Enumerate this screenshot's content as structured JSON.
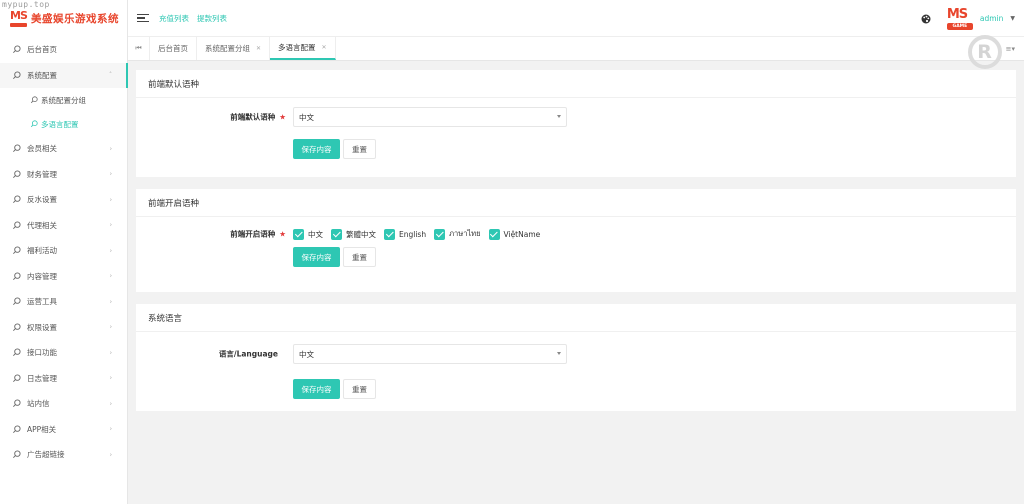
{
  "app": {
    "watermark": "mypup.top",
    "title": "美盛娱乐游戏系统",
    "logo_text": "MS",
    "avatar_text": "MS",
    "avatar_sub": "GAME"
  },
  "sidebar": {
    "items": [
      {
        "label": "后台首页"
      },
      {
        "label": "系统配置",
        "open": true
      },
      {
        "label": "会员相关"
      },
      {
        "label": "财务管理"
      },
      {
        "label": "反水设置"
      },
      {
        "label": "代理相关"
      },
      {
        "label": "福利活动"
      },
      {
        "label": "内容管理"
      },
      {
        "label": "运营工具"
      },
      {
        "label": "权限设置"
      },
      {
        "label": "接口功能"
      },
      {
        "label": "日志管理"
      },
      {
        "label": "站内信"
      },
      {
        "label": "APP相关"
      },
      {
        "label": "广告超链接"
      }
    ],
    "sub_items": [
      {
        "label": "系统配置分组"
      },
      {
        "label": "多语言配置",
        "active": true
      }
    ]
  },
  "header": {
    "links": [
      "充值列表",
      "提款列表"
    ],
    "user": "admin"
  },
  "tabs": {
    "items": [
      {
        "label": "后台首页"
      },
      {
        "label": "系统配置分组"
      },
      {
        "label": "多语言配置",
        "active": true
      }
    ],
    "reg_mark": "R"
  },
  "cards": {
    "default_lang": {
      "title": "前端默认语种",
      "label": "前端默认语种",
      "value": "中文",
      "save": "保存内容",
      "reset": "重置"
    },
    "enabled_lang": {
      "title": "前端开启语种",
      "label": "前端开启语种",
      "options": [
        "中文",
        "繁體中文",
        "English",
        "ภาษาไทย",
        "ViệtName"
      ],
      "save": "保存内容",
      "reset": "重置"
    },
    "system_lang": {
      "title": "系统语言",
      "label": "语言/Language",
      "value": "中文",
      "save": "保存内容",
      "reset": "重置"
    }
  },
  "colors": {
    "accent": "#2ec7b3",
    "brand": "#e8452c",
    "required": "#e23a3a"
  }
}
